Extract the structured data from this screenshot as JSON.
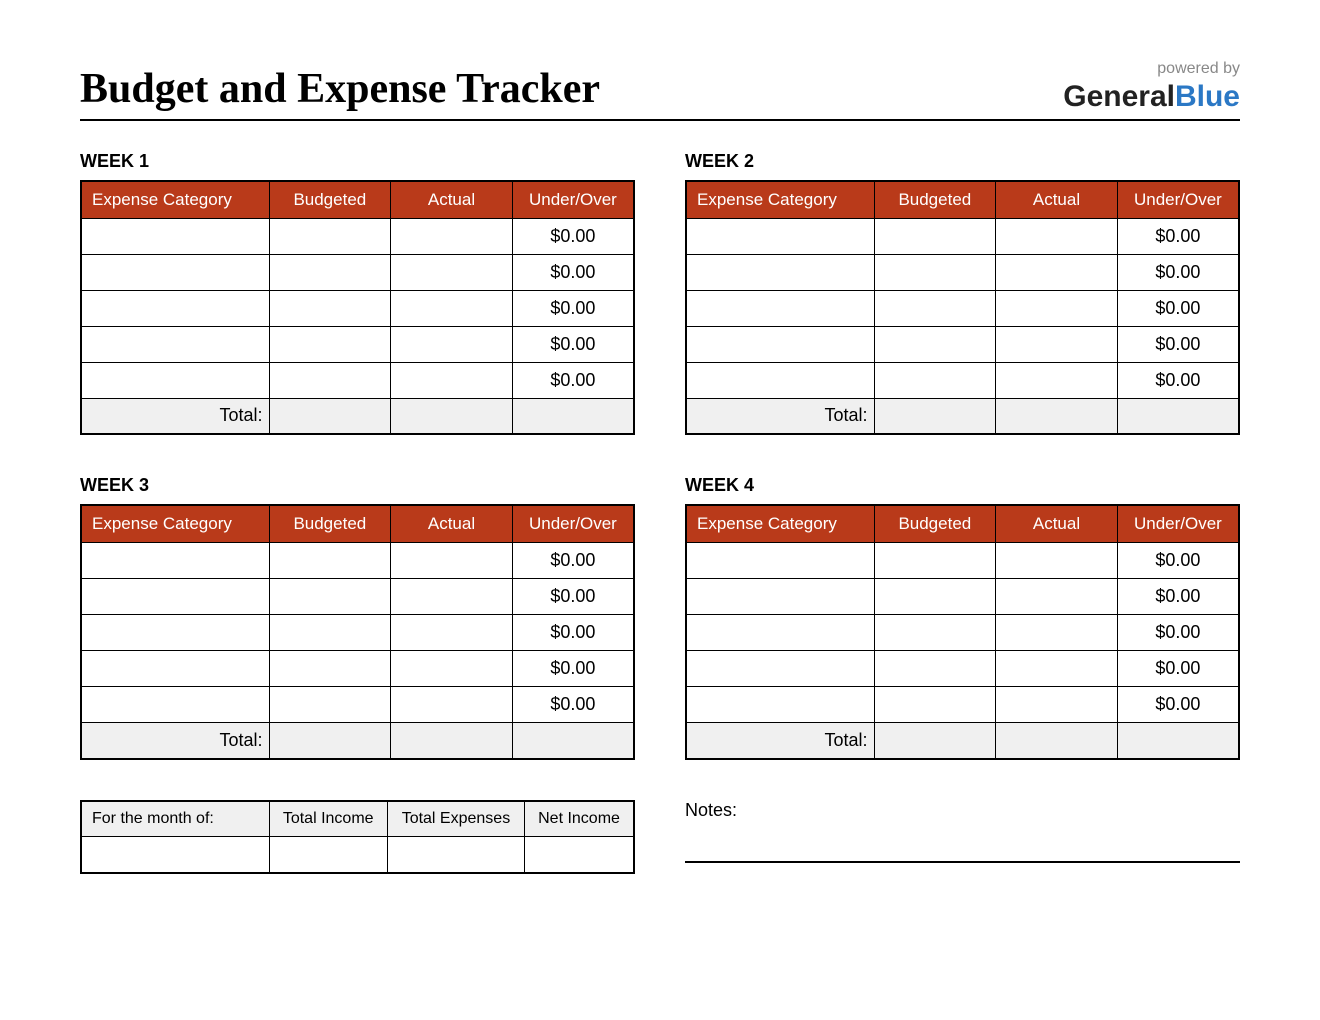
{
  "title": "Budget and Expense Tracker",
  "brand": {
    "powered": "powered by",
    "name1": "General",
    "name2": "Blue"
  },
  "columns": {
    "category": "Expense Category",
    "budgeted": "Budgeted",
    "actual": "Actual",
    "underover": "Under/Over"
  },
  "total_label": "Total:",
  "weeks": [
    {
      "label": "WEEK 1",
      "rows": [
        {
          "category": "",
          "budgeted": "",
          "actual": "",
          "underover": "$0.00"
        },
        {
          "category": "",
          "budgeted": "",
          "actual": "",
          "underover": "$0.00"
        },
        {
          "category": "",
          "budgeted": "",
          "actual": "",
          "underover": "$0.00"
        },
        {
          "category": "",
          "budgeted": "",
          "actual": "",
          "underover": "$0.00"
        },
        {
          "category": "",
          "budgeted": "",
          "actual": "",
          "underover": "$0.00"
        }
      ],
      "total": {
        "budgeted": "",
        "actual": "",
        "underover": ""
      }
    },
    {
      "label": "WEEK 2",
      "rows": [
        {
          "category": "",
          "budgeted": "",
          "actual": "",
          "underover": "$0.00"
        },
        {
          "category": "",
          "budgeted": "",
          "actual": "",
          "underover": "$0.00"
        },
        {
          "category": "",
          "budgeted": "",
          "actual": "",
          "underover": "$0.00"
        },
        {
          "category": "",
          "budgeted": "",
          "actual": "",
          "underover": "$0.00"
        },
        {
          "category": "",
          "budgeted": "",
          "actual": "",
          "underover": "$0.00"
        }
      ],
      "total": {
        "budgeted": "",
        "actual": "",
        "underover": ""
      }
    },
    {
      "label": "WEEK 3",
      "rows": [
        {
          "category": "",
          "budgeted": "",
          "actual": "",
          "underover": "$0.00"
        },
        {
          "category": "",
          "budgeted": "",
          "actual": "",
          "underover": "$0.00"
        },
        {
          "category": "",
          "budgeted": "",
          "actual": "",
          "underover": "$0.00"
        },
        {
          "category": "",
          "budgeted": "",
          "actual": "",
          "underover": "$0.00"
        },
        {
          "category": "",
          "budgeted": "",
          "actual": "",
          "underover": "$0.00"
        }
      ],
      "total": {
        "budgeted": "",
        "actual": "",
        "underover": ""
      }
    },
    {
      "label": "WEEK 4",
      "rows": [
        {
          "category": "",
          "budgeted": "",
          "actual": "",
          "underover": "$0.00"
        },
        {
          "category": "",
          "budgeted": "",
          "actual": "",
          "underover": "$0.00"
        },
        {
          "category": "",
          "budgeted": "",
          "actual": "",
          "underover": "$0.00"
        },
        {
          "category": "",
          "budgeted": "",
          "actual": "",
          "underover": "$0.00"
        },
        {
          "category": "",
          "budgeted": "",
          "actual": "",
          "underover": "$0.00"
        }
      ],
      "total": {
        "budgeted": "",
        "actual": "",
        "underover": ""
      }
    }
  ],
  "summary": {
    "month_label": "For the month of:",
    "income_label": "Total Income",
    "expenses_label": "Total Expenses",
    "net_label": "Net Income",
    "month_value": "",
    "income_value": "",
    "expenses_value": "",
    "net_value": ""
  },
  "notes_label": "Notes:"
}
